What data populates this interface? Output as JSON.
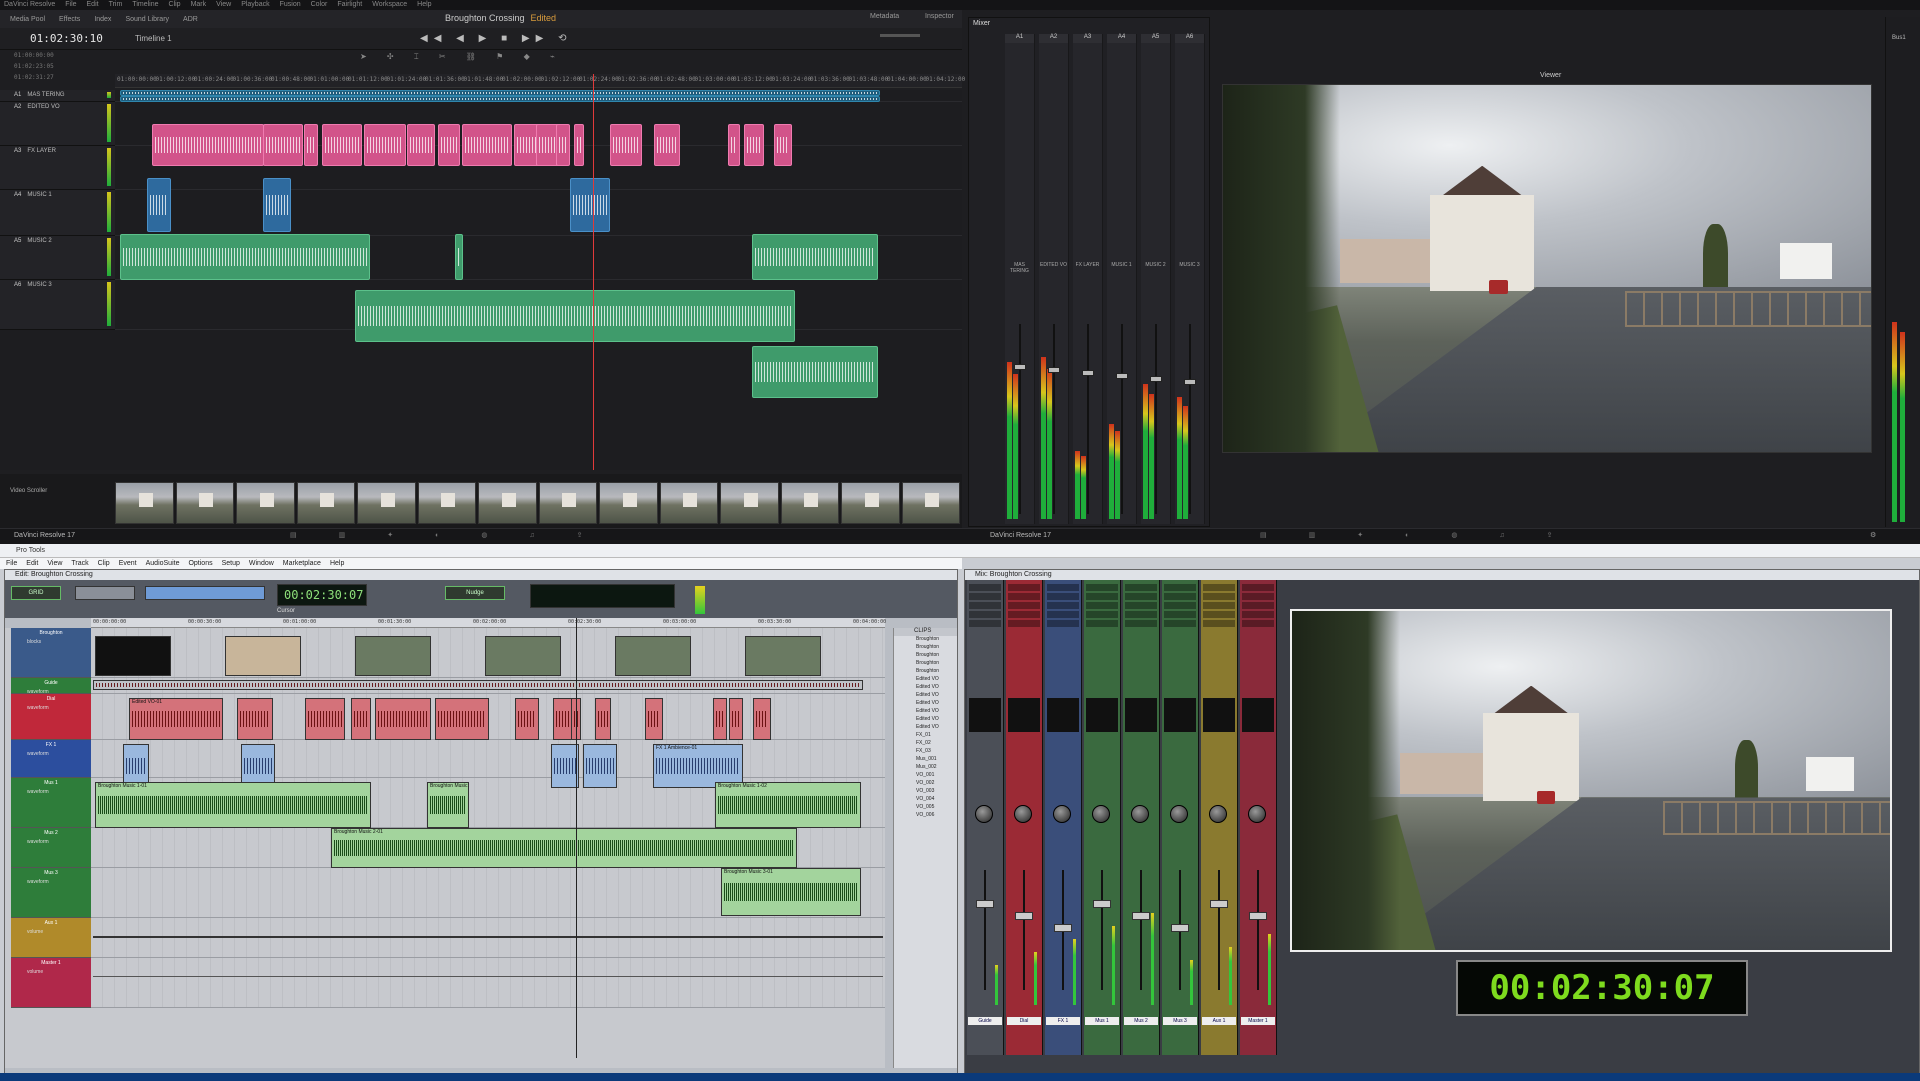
{
  "resolve": {
    "menu": [
      "DaVinci Resolve",
      "File",
      "Edit",
      "Trim",
      "Timeline",
      "Clip",
      "Mark",
      "View",
      "Playback",
      "Fusion",
      "Color",
      "Fairlight",
      "Workspace",
      "Help"
    ],
    "toolbar": [
      "Media Pool",
      "Effects",
      "Index",
      "Sound Library",
      "ADR"
    ],
    "project_title": "Broughton Crossing",
    "project_status": "Edited",
    "toolbar_right": [
      "Metadata",
      "Inspector"
    ],
    "timecode": "01:02:30:10",
    "timeline_name": "Timeline 1",
    "tc_stack": [
      "01:00:00:00",
      "01:02:23:05",
      "01:02:31:27"
    ],
    "ruler": [
      "01:00:00:00",
      "01:00:12:00",
      "01:00:24:00",
      "01:00:36:00",
      "01:00:48:00",
      "01:01:00:00",
      "01:01:12:00",
      "01:01:24:00",
      "01:01:36:00",
      "01:01:48:00",
      "01:02:00:00",
      "01:02:12:00",
      "01:02:24:00",
      "01:02:36:00",
      "01:02:48:00",
      "01:03:00:00",
      "01:03:12:00",
      "01:03:24:00",
      "01:03:36:00",
      "01:03:48:00",
      "01:04:00:00",
      "01:04:12:00"
    ],
    "tracks": [
      {
        "id": "A1",
        "name": "MAS TERING"
      },
      {
        "id": "A2",
        "name": "EDITED VO"
      },
      {
        "id": "A3",
        "name": "FX LAYER"
      },
      {
        "id": "A4",
        "name": "MUSIC 1"
      },
      {
        "id": "A5",
        "name": "MUSIC 2"
      },
      {
        "id": "A6",
        "name": "MUSIC 3"
      }
    ],
    "video_scroller_label": "Video Scroller",
    "mixer_title": "Mixer",
    "mixer_channels": [
      "A1",
      "A2",
      "A3",
      "A4",
      "A5",
      "A6"
    ],
    "mixer_bus": "Bus1",
    "mixer_tags": [
      "MAS TERING",
      "EDITED VO",
      "FX LAYER",
      "MUSIC 1",
      "MUSIC 2",
      "MUSIC 3"
    ],
    "viewer_title": "Viewer",
    "brand": "DaVinci Resolve 17",
    "meters": {
      "a1": 0.58,
      "a2": 0.6,
      "a3": 0.25,
      "a4": 0.35,
      "a5": 0.5,
      "a6": 0.45
    }
  },
  "protools": {
    "app_title": "Pro Tools",
    "menu": [
      "File",
      "Edit",
      "View",
      "Track",
      "Clip",
      "Event",
      "AudioSuite",
      "Options",
      "Setup",
      "Window",
      "Marketplace",
      "Help"
    ],
    "edit_window_title": "Edit: Broughton Crossing",
    "mix_window_title": "Mix: Broughton Crossing",
    "counter": "00:02:30:07",
    "cursor_label": "Cursor",
    "grid_label": "GRID",
    "nudge_label": "Nudge",
    "ruler": [
      "00:00:00:00",
      "00:00:30:00",
      "00:01:00:00",
      "00:01:30:00",
      "00:02:00:00",
      "00:02:30:00",
      "00:03:00:00",
      "00:03:30:00",
      "00:04:00:00"
    ],
    "tracks": [
      {
        "name": "Broughton",
        "sub": "blocks",
        "color": "#3a5a8a"
      },
      {
        "name": "Guide",
        "sub": "waveform",
        "color": "#2e7d3a"
      },
      {
        "name": "Dial",
        "sub": "waveform",
        "color": "#c0283a"
      },
      {
        "name": "FX 1",
        "sub": "waveform",
        "color": "#2c4e9e"
      },
      {
        "name": "Mus 1",
        "sub": "waveform",
        "color": "#2e7d3a"
      },
      {
        "name": "Mus 2",
        "sub": "waveform",
        "color": "#2e7d3a"
      },
      {
        "name": "Mus 3",
        "sub": "waveform",
        "color": "#2e7d3a"
      },
      {
        "name": "Aux 1",
        "sub": "volume",
        "color": "#b08a2a"
      },
      {
        "name": "Master 1",
        "sub": "volume",
        "color": "#b0284a"
      }
    ],
    "clips_header": "CLIPS",
    "clip_list": [
      "Broughton",
      "Broughton",
      "Broughton",
      "Broughton",
      "Broughton",
      "Edited VO",
      "Edited VO",
      "Edited VO",
      "Edited VO",
      "Edited VO",
      "Edited VO",
      "Edited VO",
      "FX_01",
      "FX_02",
      "FX_03",
      "Mus_001",
      "Mus_002",
      "VO_001",
      "VO_002",
      "VO_003",
      "VO_004",
      "VO_005",
      "VO_006"
    ],
    "clip_labels": {
      "dial": "Edited VO-01",
      "mus1a": "Broughton Music 1-01",
      "mus1b": "Broughton Music",
      "mus1c": "Broughton Music 1-02",
      "mus2": "Broughton Music 2-01",
      "mus3": "Broughton Music 3-01",
      "fx": "FX 1 Ambience-01"
    },
    "mix_strips": [
      "Guide",
      "Dial",
      "FX 1",
      "Mus 1",
      "Mus 2",
      "Mus 3",
      "Aux 1",
      "Master 1"
    ],
    "mix_strip_colors": [
      "#4b4f57",
      "#9b2a35",
      "#3a4e7a",
      "#3a6a3f",
      "#3a6a3f",
      "#3a6a3f",
      "#8a7a2f",
      "#8a2a3a"
    ],
    "big_timecode": "00:02:30:07"
  }
}
